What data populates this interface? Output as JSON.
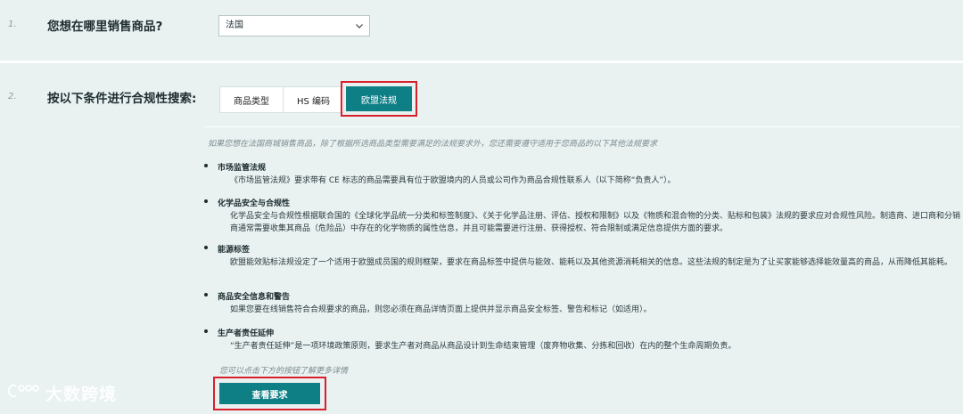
{
  "step1": {
    "number": "1.",
    "question": "您想在哪里销售商品?"
  },
  "country_select": {
    "value": "法国"
  },
  "step2": {
    "number": "2.",
    "question": "按以下条件进行合规性搜索:"
  },
  "search_tabs": [
    {
      "label": "商品类型",
      "active": false
    },
    {
      "label": "HS 编码",
      "active": false
    },
    {
      "label": "欧盟法规",
      "active": true
    }
  ],
  "intro_text": "如果您想在法国商城销售商品，除了根据所选商品类型需要满足的法规要求外，您还需要遵守适用于您商品的以下其他法规要求",
  "regulations": [
    {
      "title": "市场监管法规",
      "body": "《市场监管法规》要求带有 CE 标志的商品需要具有位于欧盟境内的人员或公司作为商品合规性联系人（以下简称“负责人”）。"
    },
    {
      "title": "化学品安全与合规性",
      "body": "化学品安全与合规性根据联合国的《全球化学品统一分类和标签制度》、《关于化学品注册、评估、授权和限制》以及《物质和混合物的分类、贴标和包装》法规的要求应对合规性风险。制造商、进口商和分销商通常需要收集其商品（危险品）中存在的化学物质的属性信息，并且可能需要进行注册、获得授权、符合限制或满足信息提供方面的要求。"
    },
    {
      "title": "能源标签",
      "body": "欧盟能效贴标法规设定了一个适用于欧盟成员国的规则框架，要求在商品标签中提供与能效、能耗以及其他资源消耗相关的信息。这些法规的制定是为了让买家能够选择能效量高的商品，从而降低其能耗。"
    },
    {
      "title": "商品安全信息和警告",
      "body": "如果您要在线销售符合合规要求的商品，则您必须在商品详情页面上提供并显示商品安全标签、警告和标记（如适用）。"
    },
    {
      "title": "生产者责任延伸",
      "body": "“生产者责任延伸”是一项环境政策原则，要求生产者对商品从商品设计到生命结束管理（废弃物收集、分拣和回收）在内的整个生命周期负责。"
    }
  ],
  "footer_note": "您可以点击下方的按钮了解更多详情",
  "cta_label": "查看要求",
  "watermark_text": "大数跨境",
  "colors": {
    "accent": "#0f7f86",
    "highlight": "#d8202b",
    "background": "#e9f1f1"
  }
}
